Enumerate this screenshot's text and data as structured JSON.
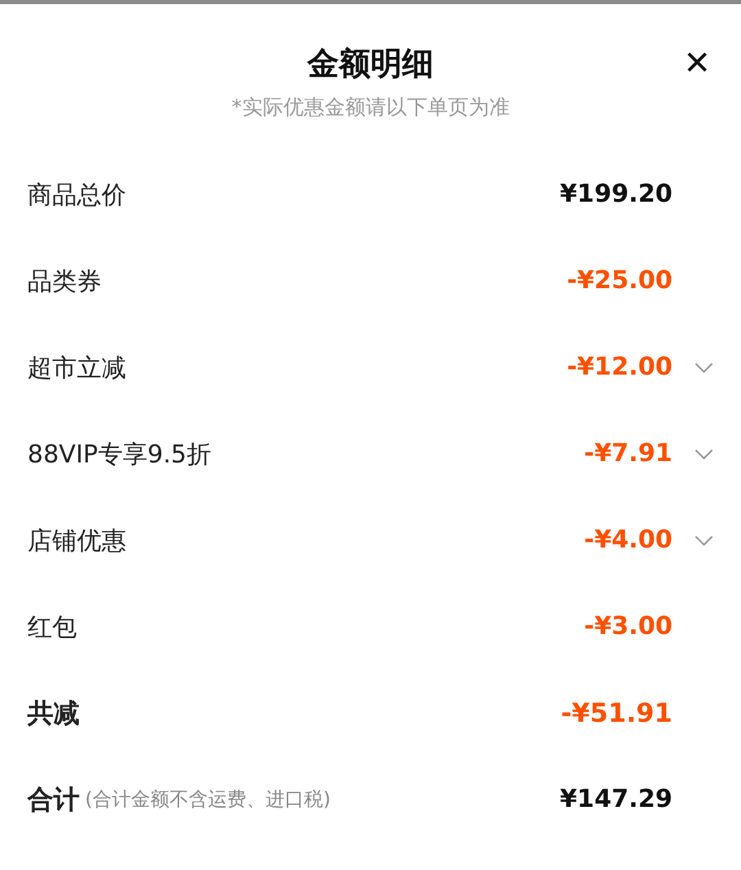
{
  "header": {
    "title": "金额明细",
    "close": "✕",
    "note": "*实际优惠金额请以下单页为准"
  },
  "rows": [
    {
      "label": "商品总价",
      "amount": "¥199.20",
      "kind": "price",
      "expandable": false
    },
    {
      "label": "品类券",
      "amount": "-¥25.00",
      "kind": "discount",
      "expandable": false
    },
    {
      "label": "超市立减",
      "amount": "-¥12.00",
      "kind": "discount",
      "expandable": true
    },
    {
      "label": "88VIP专享9.5折",
      "amount": "-¥7.91",
      "kind": "discount",
      "expandable": true
    },
    {
      "label": "店铺优惠",
      "amount": "-¥4.00",
      "kind": "discount",
      "expandable": true
    },
    {
      "label": "红包",
      "amount": "-¥3.00",
      "kind": "discount",
      "expandable": false
    },
    {
      "label": "共减",
      "amount": "-¥51.91",
      "kind": "discount-total",
      "expandable": false
    }
  ],
  "total": {
    "label": "合计",
    "note": "(合计金额不含运费、进口税)",
    "amount": "¥147.29"
  }
}
